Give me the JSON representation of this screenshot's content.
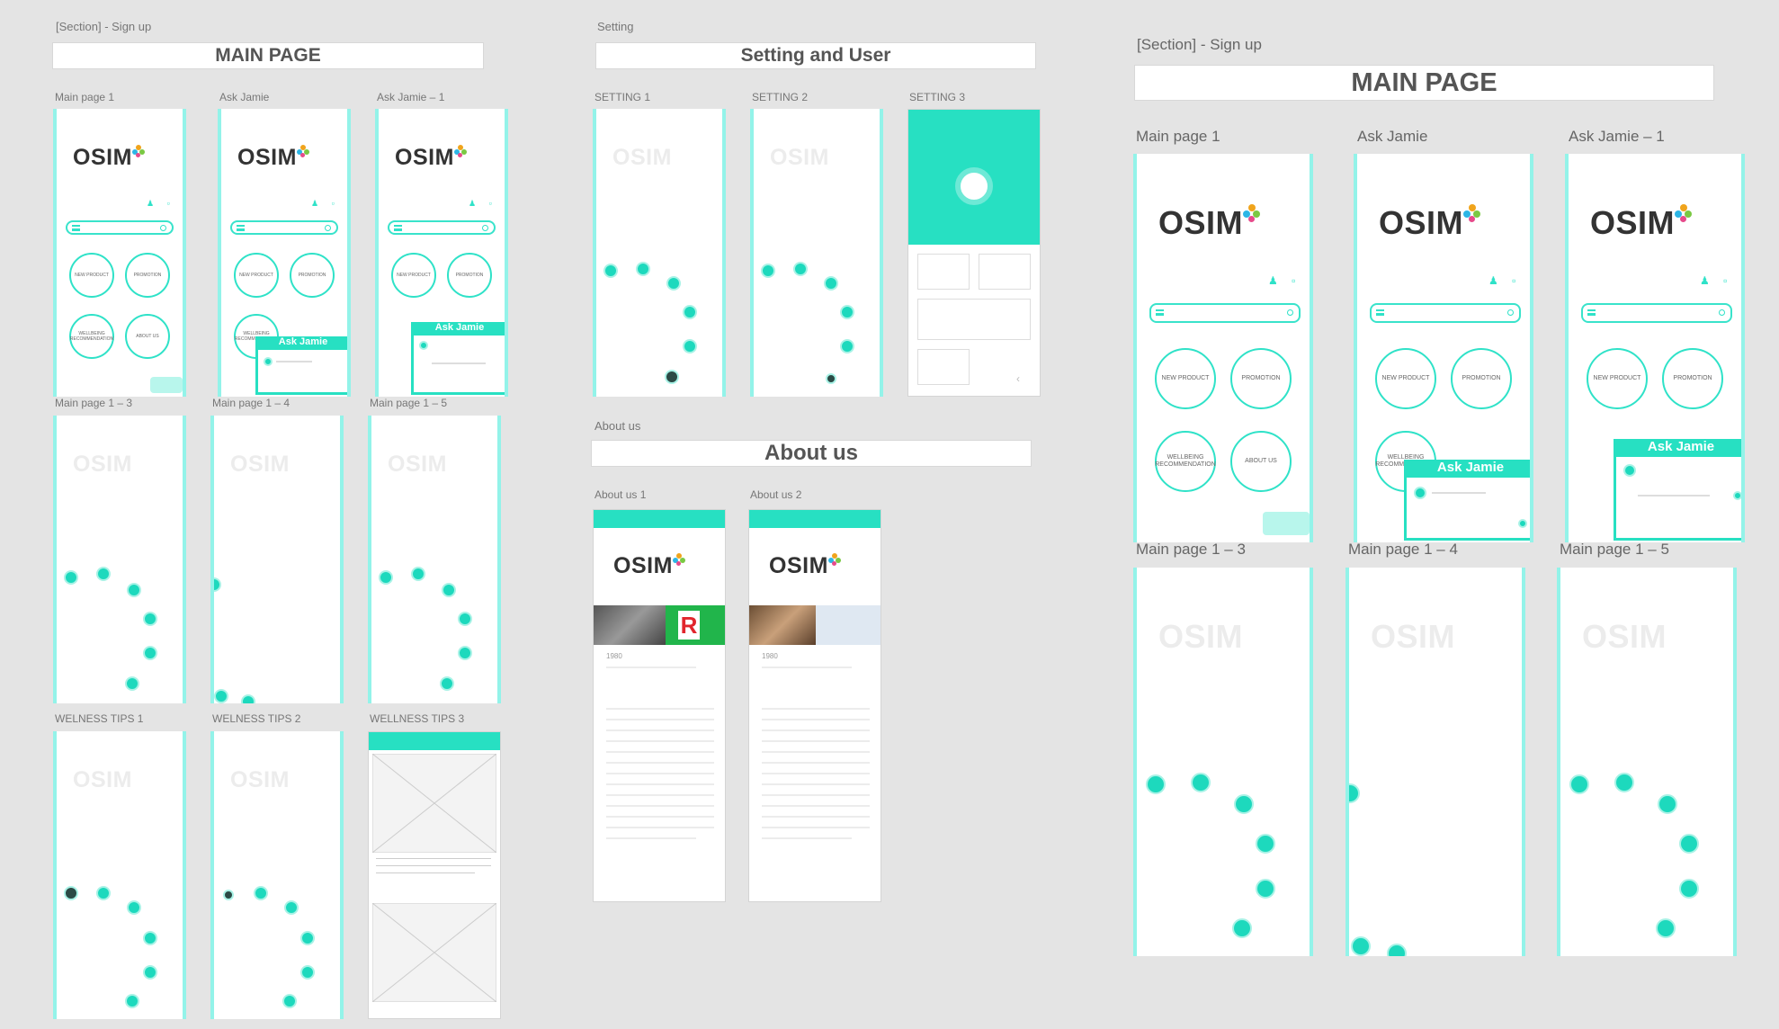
{
  "sections": {
    "left_signup_label": "[Section] - Sign up",
    "left_main_title": "MAIN PAGE",
    "setting_label": "Setting",
    "setting_title": "Setting and User",
    "about_label": "About us",
    "about_title": "About us",
    "right_signup_label": "[Section] - Sign up",
    "right_main_title": "MAIN PAGE"
  },
  "frames": {
    "main_page_1": "Main page 1",
    "ask_jamie": "Ask Jamie",
    "ask_jamie_1": "Ask Jamie – 1",
    "main_page_1_3": "Main page 1 – 3",
    "main_page_1_4": "Main page 1 – 4",
    "main_page_1_5": "Main page 1 – 5",
    "welness_tips_1": "WELNESS TIPS 1",
    "welness_tips_2": "WELNESS TIPS 2",
    "wellness_tips_3": "WELLNESS TIPS 3",
    "setting_1": "SETTING 1",
    "setting_2": "SETTING 2",
    "setting_3": "SETTING 3",
    "about_us_1": "About us 1",
    "about_us_2": "About us 2"
  },
  "brand": {
    "logo": "OSIM",
    "teal": "#27e0c2",
    "frame_border": "#93f3e9"
  },
  "home_buttons": {
    "new_product": "NEW PRODUCT",
    "promotion": "PROMOTION",
    "wellbeing": "WELLBEING RECOMMENDATION",
    "about_us": "ABOUT US"
  },
  "ask_jamie": {
    "header": "Ask Jamie"
  },
  "about": {
    "year": "1980"
  },
  "icons": [
    "user-icon",
    "cart-icon",
    "menu-icon",
    "search-icon",
    "flower-icon",
    "heart-icon",
    "chat-icon",
    "location-icon",
    "settings-icon",
    "back-icon"
  ]
}
